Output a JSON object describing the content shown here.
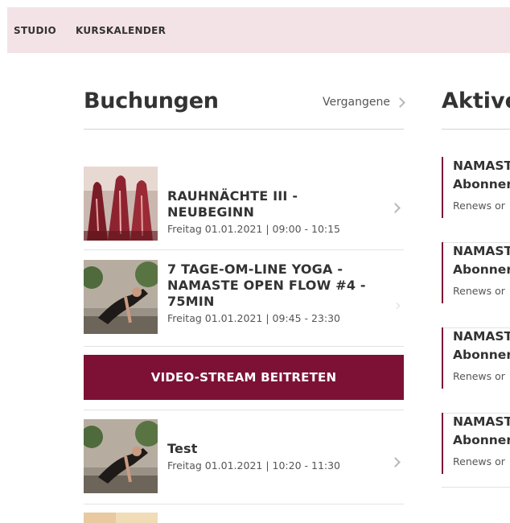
{
  "nav": {
    "studio": "STUDIO",
    "kurskalender": "KURSKALENDER"
  },
  "bookings": {
    "title": "Buchungen",
    "past_link": "Vergangene",
    "items": [
      {
        "title": "RAUHNÄCHTE III -NEUBEGINN",
        "date": "Freitag 01.01.2021 | 09:00 - 10:15"
      },
      {
        "title": "7 TAGE-OM-LINE YOGA -NAMASTE OPEN FLOW  #4 - 75MIN",
        "date": "Freitag 01.01.2021 | 09:45 - 23:30"
      },
      {
        "title": "Test",
        "date": "Freitag 01.01.2021 | 10:20 - 11:30"
      }
    ],
    "stream_button": "VIDEO-STREAM BEITRETEN"
  },
  "active": {
    "title": "Aktive",
    "items": [
      {
        "line1": "NAMAST",
        "line2": "Abonner",
        "renew": "Renews or"
      },
      {
        "line1": "NAMAST",
        "line2": "Abonner",
        "renew": "Renews or"
      },
      {
        "line1": "NAMAST",
        "line2": "Abonner",
        "renew": "Renews or"
      },
      {
        "line1": "NAMAST",
        "line2": "Abonner",
        "renew": "Renews or"
      }
    ]
  },
  "colors": {
    "topbar": "#f3e3e7",
    "accent": "#7d1135"
  }
}
